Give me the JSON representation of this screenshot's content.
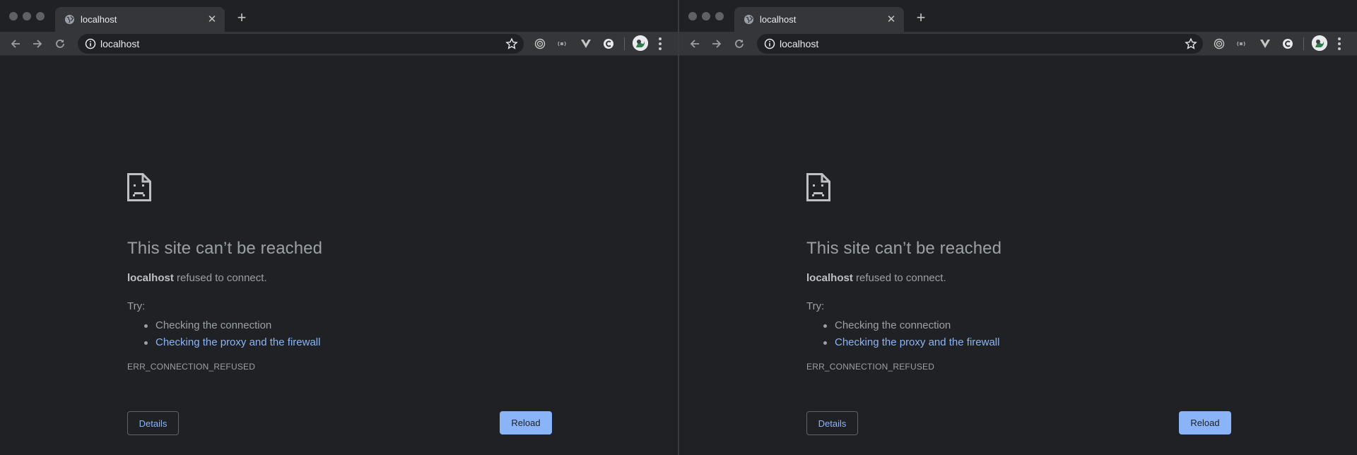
{
  "windows": [
    {
      "tab": {
        "title": "localhost",
        "favicon": "globe-icon",
        "close_glyph": "✕"
      },
      "new_tab_glyph": "+",
      "toolbar": {
        "url": "localhost"
      },
      "error": {
        "heading": "This site can’t be reached",
        "host": "localhost",
        "message": " refused to connect.",
        "try_label": "Try:",
        "suggestions": [
          "Checking the connection",
          "Checking the proxy and the firewall"
        ],
        "code": "ERR_CONNECTION_REFUSED",
        "details_label": "Details",
        "reload_label": "Reload"
      }
    },
    {
      "tab": {
        "title": "localhost",
        "favicon": "globe-icon",
        "close_glyph": "✕"
      },
      "new_tab_glyph": "+",
      "toolbar": {
        "url": "localhost"
      },
      "error": {
        "heading": "This site can’t be reached",
        "host": "localhost",
        "message": " refused to connect.",
        "try_label": "Try:",
        "suggestions": [
          "Checking the connection",
          "Checking the proxy and the firewall"
        ],
        "code": "ERR_CONNECTION_REFUSED",
        "details_label": "Details",
        "reload_label": "Reload"
      }
    }
  ],
  "colors": {
    "accent": "#8ab4f8",
    "background": "#202124",
    "toolbar": "#35363a",
    "text_muted": "#9aa0a6"
  }
}
